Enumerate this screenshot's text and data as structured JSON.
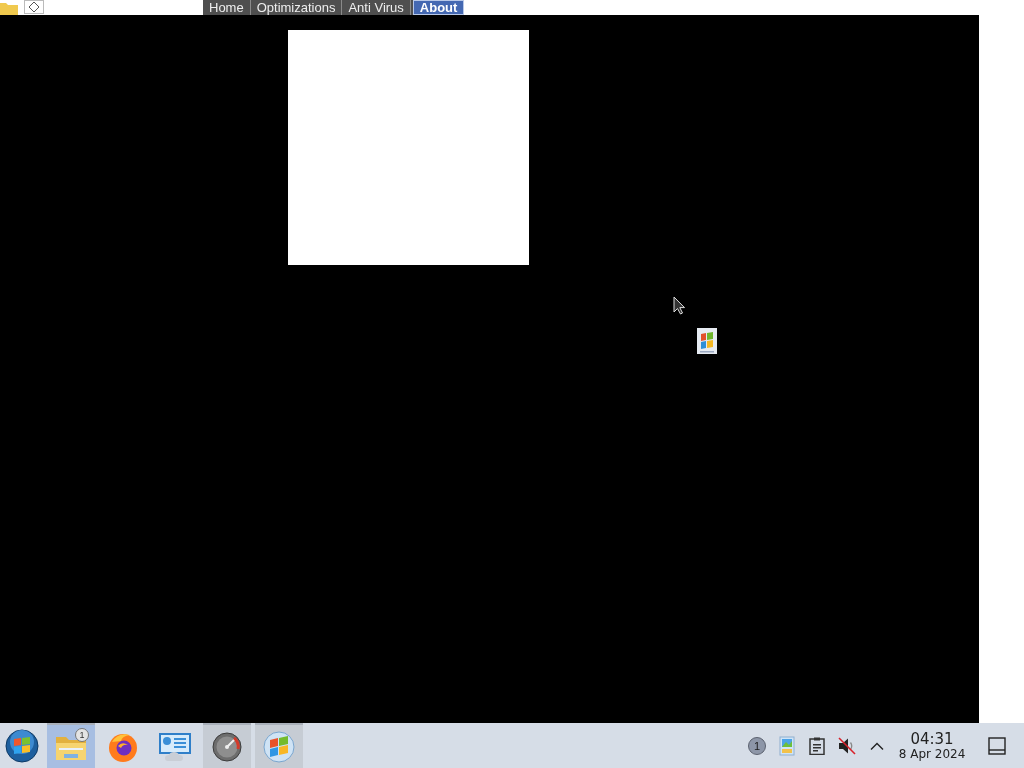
{
  "browser_strip": {
    "tabs": [
      {
        "label": "Home",
        "selected": false
      },
      {
        "label": "Optimizations",
        "selected": false
      },
      {
        "label": "Anti Virus",
        "selected": false
      },
      {
        "label": "About",
        "selected": true
      }
    ]
  },
  "taskbar": {
    "apps": [
      {
        "kind": "folder",
        "selected": true,
        "running": true,
        "badge": "1"
      },
      {
        "kind": "browser",
        "selected": false,
        "running": false
      },
      {
        "kind": "monitor",
        "selected": false,
        "running": false
      },
      {
        "kind": "gauge",
        "selected": false,
        "running": true
      },
      {
        "kind": "flag",
        "selected": false,
        "running": true
      }
    ],
    "tray": [
      {
        "kind": "counter",
        "label": "1"
      },
      {
        "kind": "photos"
      },
      {
        "kind": "clipboard"
      },
      {
        "kind": "speaker",
        "muted": true
      },
      {
        "kind": "expand"
      }
    ],
    "clock": {
      "time": "04:31",
      "date": "8 Apr 2024"
    }
  }
}
